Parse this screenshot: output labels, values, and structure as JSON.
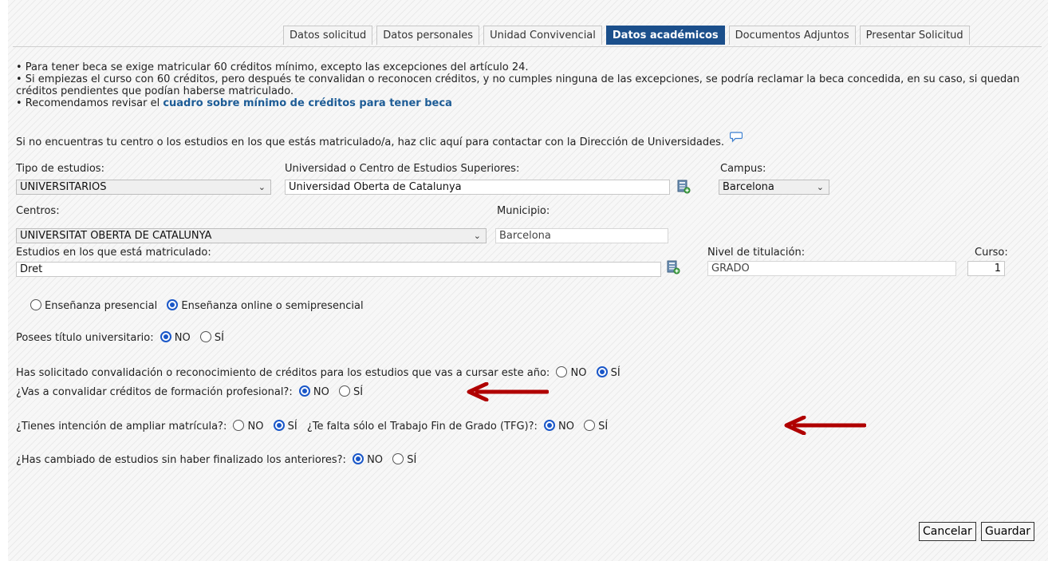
{
  "tabs": [
    "Datos solicitud",
    "Datos personales",
    "Unidad Convivencial",
    "Datos académicos",
    "Documentos Adjuntos",
    "Presentar Solicitud"
  ],
  "info": {
    "line1": "• Para tener beca se exige matricular 60 créditos mínimo, excepto las excepciones del artículo 24.",
    "line2": "• Si empiezas el curso con 60 créditos, pero después te convalidan o reconocen créditos, y no cumples ninguna de las excepciones, se podría reclamar la beca concedida, en su caso, si quedan créditos pendientes que podían haberse matriculado.",
    "line3_prefix": "• Recomendamos revisar el ",
    "line3_link": "cuadro sobre mínimo de créditos para tener beca"
  },
  "contact_text": "Si no encuentras tu centro o los estudios en los que estás matriculado/a, haz clic aquí para contactar con la Dirección de Universidades.",
  "form": {
    "tipo_label": "Tipo de estudios:",
    "tipo_value": "UNIVERSITARIOS",
    "universidad_label": "Universidad o Centro de Estudios Superiores:",
    "universidad_value": "Universidad Oberta de Catalunya",
    "campus_label": "Campus:",
    "campus_value": "Barcelona",
    "centros_label": "Centros:",
    "centros_value": "UNIVERSITAT OBERTA DE CATALUNYA",
    "municipio_label": "Municipio:",
    "municipio_value": "Barcelona",
    "estudios_label": "Estudios en los que está matriculado:",
    "estudios_value": "Dret",
    "nivel_label": "Nivel de titulación:",
    "nivel_value": "GRADO",
    "curso_label": "Curso:",
    "curso_value": "1"
  },
  "modalidad": {
    "presencial": "Enseñanza presencial",
    "online": "Enseñanza online o semipresencial",
    "selected": "online"
  },
  "questions": {
    "titulo": "Posees título universitario:",
    "convalidacion": "Has solicitado convalidación o reconocimiento de créditos para los estudios que vas a cursar este año:",
    "fp": "¿Vas a convalidar créditos de formación profesional?:",
    "ampliar": "¿Tienes intención de ampliar matrícula?:",
    "tfg": "¿Te falta sólo el Trabajo Fin de Grado (TFG)?:",
    "cambiado": "¿Has cambiado de estudios sin haber finalizado los anteriores?:",
    "no": "NO",
    "si": "SÍ"
  },
  "buttons": {
    "cancel": "Cancelar",
    "save": "Guardar"
  },
  "colors": {
    "tab_active": "#1b4f8b",
    "link": "#1d5c96",
    "radio": "#1a57c8",
    "arrow": "#b00000"
  }
}
